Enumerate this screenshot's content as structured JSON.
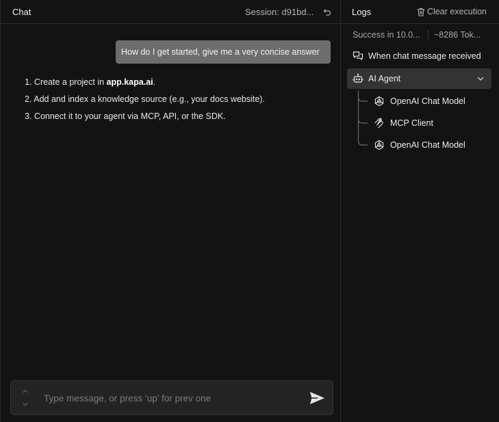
{
  "chat": {
    "title": "Chat",
    "session_label": "Session: d91bd...",
    "user_message": "How do I get started, give me a very concise answer",
    "answer": [
      {
        "number": "1.",
        "before": "Create a project in ",
        "bold": "app.kapa.ai",
        "after": "."
      },
      {
        "number": "2.",
        "before": "Add and index a knowledge source (e.g., your docs website).",
        "bold": "",
        "after": ""
      },
      {
        "number": "3.",
        "before": "Connect it to your agent via MCP, API, or the SDK.",
        "bold": "",
        "after": ""
      }
    ],
    "composer": {
      "placeholder": "Type message, or press ‘up’ for prev one",
      "value": ""
    }
  },
  "logs": {
    "title": "Logs",
    "clear_label": "Clear execution",
    "stats": {
      "success": "Success in 10.0...",
      "tokens": "~8286 Tok..."
    },
    "trigger": {
      "label": "When chat message received",
      "icon": "chat-bubbles-icon"
    },
    "agent": {
      "label": "AI Agent",
      "icon": "robot-icon",
      "expanded": true
    },
    "children": [
      {
        "label": "OpenAI Chat Model",
        "icon": "openai-icon"
      },
      {
        "label": "MCP Client",
        "icon": "mcp-icon"
      },
      {
        "label": "OpenAI Chat Model",
        "icon": "openai-icon"
      }
    ]
  },
  "colors": {
    "background": "#131313",
    "user_bubble": "#6d6d6d",
    "selected_row": "#333333",
    "composer_bg": "#232323"
  }
}
